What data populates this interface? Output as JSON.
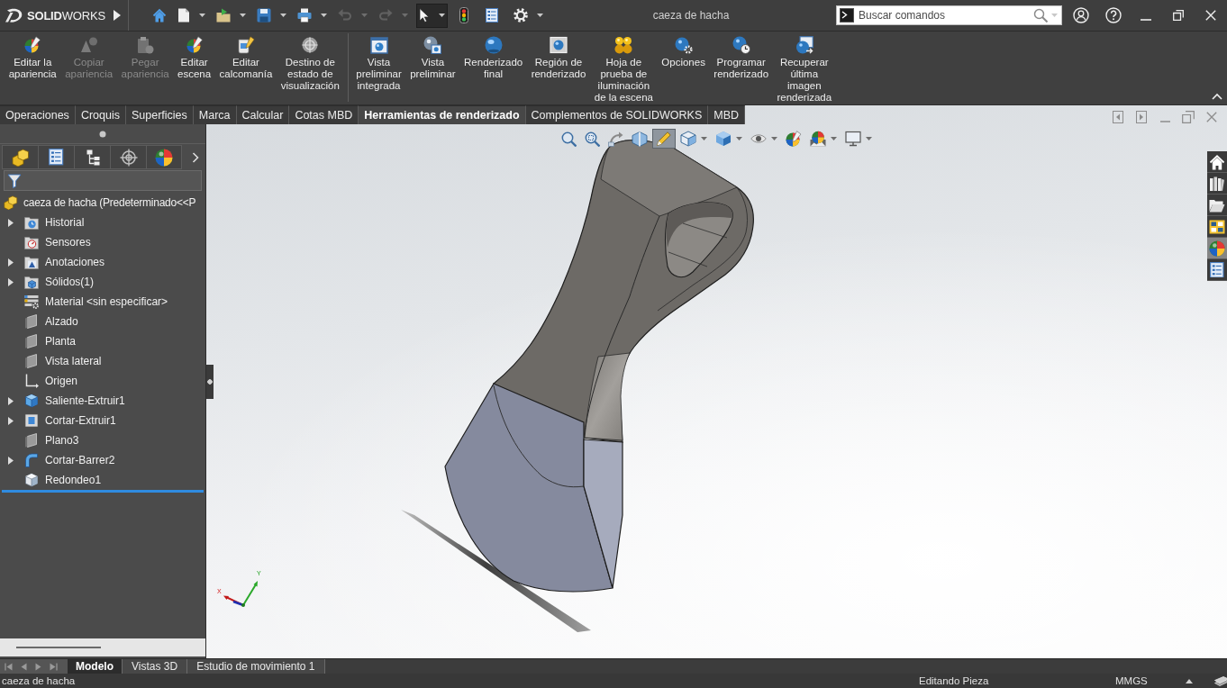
{
  "title_bar": {
    "logo": "**SOLID**WORKS",
    "title": "caeza de hacha",
    "search": {
      "placeholder": "Buscar comandos"
    }
  },
  "quick_access": [
    {
      "disabled": false,
      "selected": false
    },
    {
      "disabled": false,
      "selected": false
    },
    {
      "disabled": false,
      "selected": false
    },
    {
      "disabled": false,
      "selected": false
    },
    {
      "disabled": false,
      "selected": false
    },
    {
      "disabled": true,
      "selected": false
    },
    {
      "disabled": true,
      "selected": false
    },
    {
      "disabled": false,
      "selected": true
    },
    {
      "disabled": false,
      "selected": false
    },
    {
      "disabled": false,
      "selected": false
    },
    {
      "disabled": false,
      "selected": false
    }
  ],
  "ribbon": {
    "groups": [
      {
        "buttons": [
          {
            "label": "Editar la\napariencia",
            "disabled": false
          },
          {
            "label": "Copiar\napariencia",
            "disabled": true
          },
          {
            "label": "Pegar\napariencia",
            "disabled": true
          },
          {
            "label": "Editar\nescena",
            "disabled": false
          },
          {
            "label": "Editar\ncalcomanía",
            "disabled": false
          },
          {
            "label": "Destino de\nestado de\nvisualización",
            "disabled": false
          }
        ]
      },
      {
        "buttons": [
          {
            "label": "Vista\npreliminar\nintegrada",
            "disabled": false
          },
          {
            "label": "Vista\npreliminar",
            "disabled": false
          },
          {
            "label": "Renderizado\nfinal",
            "disabled": false
          },
          {
            "label": "Región de\nrenderizado",
            "disabled": false
          },
          {
            "label": "Hoja de\nprueba de\niluminación\nde la escena",
            "disabled": false
          },
          {
            "label": "Opciones",
            "disabled": false
          },
          {
            "label": "Programar\nrenderizado",
            "disabled": false
          },
          {
            "label": "Recuperar\núltima\nimagen\nrenderizada",
            "disabled": false
          }
        ]
      }
    ]
  },
  "command_tabs": [
    {
      "label": "Operaciones",
      "selected": false
    },
    {
      "label": "Croquis",
      "selected": false
    },
    {
      "label": "Superficies",
      "selected": false
    },
    {
      "label": "Marca",
      "selected": false
    },
    {
      "label": "Calcular",
      "selected": false
    },
    {
      "label": "Cotas MBD",
      "selected": false
    },
    {
      "label": "Herramientas de renderizado",
      "selected": true
    },
    {
      "label": "Complementos de SOLIDWORKS",
      "selected": false
    },
    {
      "label": "MBD",
      "selected": false
    }
  ],
  "feature_manager": {
    "tree": {
      "label": "caeza de hacha (Predeterminado<<P",
      "kind": "part",
      "children": [
        {
          "label": "Historial",
          "kind": "history",
          "collapsed": true
        },
        {
          "label": "Sensores",
          "kind": "sensors",
          "collapsed": false
        },
        {
          "label": "Anotaciones",
          "kind": "annotations",
          "collapsed": true
        },
        {
          "label": "Sólidos(1)",
          "kind": "solids",
          "collapsed": true
        },
        {
          "label": "Material <sin especificar>",
          "kind": "material",
          "collapsed": false
        },
        {
          "label": "Alzado",
          "kind": "plane",
          "collapsed": false
        },
        {
          "label": "Planta",
          "kind": "plane",
          "collapsed": false
        },
        {
          "label": "Vista lateral",
          "kind": "plane",
          "collapsed": false
        },
        {
          "label": "Origen",
          "kind": "origin",
          "collapsed": false
        },
        {
          "label": "Saliente-Extruir1",
          "kind": "boss",
          "collapsed": true
        },
        {
          "label": "Cortar-Extruir1",
          "kind": "cut",
          "collapsed": true
        },
        {
          "label": "Plano3",
          "kind": "plane",
          "collapsed": false
        },
        {
          "label": "Cortar-Barrer2",
          "kind": "sweep",
          "collapsed": true
        },
        {
          "label": "Redondeo1",
          "kind": "fillet",
          "collapsed": false
        }
      ]
    }
  },
  "view_toolbar": [
    {
      "selected": false
    },
    {
      "selected": false
    },
    {
      "selected": false
    },
    {
      "selected": false
    },
    {
      "selected": true
    },
    {
      "selected": false
    },
    {
      "selected": false
    },
    {
      "selected": false
    },
    {
      "selected": false
    },
    {
      "selected": false
    },
    {
      "selected": false
    }
  ],
  "task_pane": [
    {
      "selected": false
    },
    {
      "selected": false
    },
    {
      "selected": false
    },
    {
      "selected": false
    },
    {
      "selected": true
    },
    {
      "selected": false
    }
  ],
  "triad": {
    "x_label": "X",
    "y_label": "Y"
  },
  "model_tabs": [
    {
      "label": "Modelo",
      "selected": true
    },
    {
      "label": "Vistas 3D",
      "selected": false
    },
    {
      "label": "Estudio de movimiento 1",
      "selected": false
    }
  ],
  "status_bar": {
    "document": "caeza de hacha",
    "mode": "Editando Pieza",
    "units": "MMGS"
  }
}
